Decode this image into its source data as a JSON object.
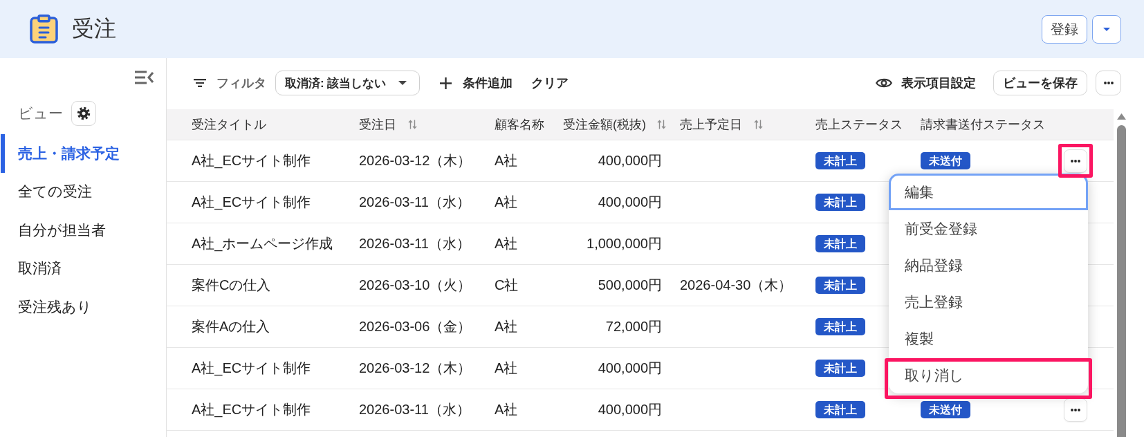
{
  "header": {
    "title": "受注",
    "buttons": [
      {
        "kind": "text",
        "label": "登録"
      },
      {
        "kind": "dropdown"
      }
    ]
  },
  "sidebar": {
    "views_label": "ビュー",
    "items": [
      {
        "label": "売上・請求予定",
        "selected": true
      },
      {
        "label": "全ての受注",
        "selected": false
      },
      {
        "label": "自分が担当者",
        "selected": false
      },
      {
        "label": "取消済",
        "selected": false
      },
      {
        "label": "受注残あり",
        "selected": false
      }
    ]
  },
  "toolbar": {
    "filter_label": "フィルタ",
    "filter_chip": "取消済: 該当しない",
    "add_condition": "条件追加",
    "clear": "クリア",
    "column_settings": "表示項目設定",
    "save_view": "ビューを保存"
  },
  "table": {
    "columns": [
      {
        "label": "受注タイトル",
        "kind": "text",
        "sortable": false
      },
      {
        "label": "受注日",
        "kind": "text",
        "sortable": true
      },
      {
        "label": "顧客名称",
        "kind": "text",
        "sortable": false
      },
      {
        "label": "受注金額(税抜)",
        "kind": "amount",
        "sortable": true
      },
      {
        "label": "売上予定日",
        "kind": "text",
        "sortable": true
      },
      {
        "label": "売上ステータス",
        "kind": "status",
        "sortable": false
      },
      {
        "label": "請求書送付ステータス",
        "kind": "status",
        "sortable": false
      }
    ],
    "rows": [
      {
        "title": "A社_ECサイト制作",
        "order_date": "2026-03-12（木）",
        "customer": "A社",
        "amount": "400,000円",
        "sales_status": "未計上",
        "invoice_status": "未送付",
        "actions": {
          "highlighted": true
        }
      },
      {
        "title": "A社_ECサイト制作",
        "order_date": "2026-03-11（水）",
        "customer": "A社",
        "amount": "400,000円",
        "sales_status": "未計上"
      },
      {
        "title": "A社_ホームページ作成",
        "order_date": "2026-03-11（水）",
        "customer": "A社",
        "amount": "1,000,000円",
        "sales_status": "未計上"
      },
      {
        "title": "案件Cの仕入",
        "order_date": "2026-03-10（火）",
        "customer": "C社",
        "amount": "500,000円",
        "planned_sales_date": "2026-04-30（木）",
        "sales_status": "未計上"
      },
      {
        "title": "案件Aの仕入",
        "order_date": "2026-03-06（金）",
        "customer": "A社",
        "amount": "72,000円",
        "sales_status": "未計上"
      },
      {
        "title": "A社_ECサイト制作",
        "order_date": "2026-03-12（木）",
        "customer": "A社",
        "amount": "400,000円",
        "sales_status": "未計上"
      },
      {
        "title": "A社_ECサイト制作",
        "order_date": "2026-03-11（水）",
        "customer": "A社",
        "amount": "400,000円",
        "sales_status": "未計上",
        "invoice_status": "未送付",
        "actions": {
          "highlighted": false
        }
      }
    ]
  },
  "row_menu": {
    "items": [
      {
        "label": "編集",
        "focused": true,
        "highlighted": false
      },
      {
        "label": "前受金登録",
        "focused": false,
        "highlighted": false
      },
      {
        "label": "納品登録",
        "focused": false,
        "highlighted": false
      },
      {
        "label": "売上登録",
        "focused": false,
        "highlighted": false
      },
      {
        "label": "複製",
        "focused": false,
        "highlighted": false
      },
      {
        "label": "取り消し",
        "focused": false,
        "highlighted": true
      }
    ]
  }
}
